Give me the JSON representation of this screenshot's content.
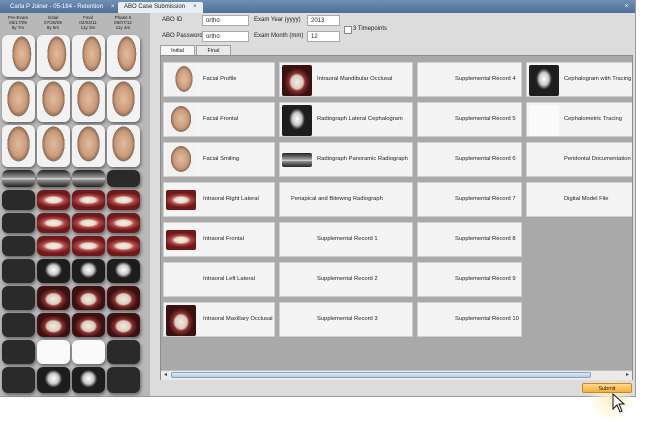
{
  "tabs": [
    {
      "label": "Carla P Joiner - 05-184 - Retention",
      "close": "×",
      "active": false
    },
    {
      "label": "ABO Case Submission",
      "close": "×",
      "active": true
    }
  ],
  "window_controls": {
    "close": "×"
  },
  "timepoints": [
    {
      "name": "Pre-Exam",
      "date": "06/17/05",
      "age": "8y 7m"
    },
    {
      "name": "Initial",
      "date": "07/28/09",
      "age": "8y 8m"
    },
    {
      "name": "Final",
      "date": "02/03/11",
      "age": "11y 3m"
    },
    {
      "name": "Phase II",
      "date": "05/07/12",
      "age": "11y 4m"
    }
  ],
  "form": {
    "abo_id_label": "ABO ID",
    "abo_id_value": "ortho",
    "abo_password_label": "ABO Password",
    "abo_password_value": "ortho",
    "exam_year_label": "Exam Year (yyyy)",
    "exam_year_value": "2013",
    "exam_month_label": "Exam Month (mm)",
    "exam_month_value": "12",
    "three_timepoints_label": "3 Timepoints"
  },
  "subtabs": [
    "Initial",
    "Final"
  ],
  "records": {
    "col1": [
      "Facial Profile",
      "Facial Frontal",
      "Facial Smiling",
      "Intraoral Right Lateral",
      "Intraoral Frontal",
      "Intraoral Left Lateral",
      "Intraoral Maxillary Occlusal"
    ],
    "col2": [
      "Intraoral Mandibular Occlusal",
      "Radiograph Lateral Cephalogram",
      "Radiograph Panoramic Radiograph",
      "Periapical and Bitewing Radiograph",
      "Supplemental Record 1",
      "Supplemental Record 2",
      "Supplemental Record 3"
    ],
    "col3": [
      "Supplemental Record 4",
      "Supplemental Record 5",
      "Supplemental Record 6",
      "Supplemental Record 7",
      "Supplemental Record 8",
      "Supplemental Record 9",
      "Supplemental Record 10"
    ],
    "col4": [
      "Cephalogram with Tracing",
      "Cephalometric Tracing",
      "Peridontal Documentation",
      "Digital Model File"
    ]
  },
  "submit_label": "Submit",
  "colors": {
    "accent": "#f5b13d",
    "tabbar": "#4f6f98",
    "panel": "#a9a9a9"
  }
}
